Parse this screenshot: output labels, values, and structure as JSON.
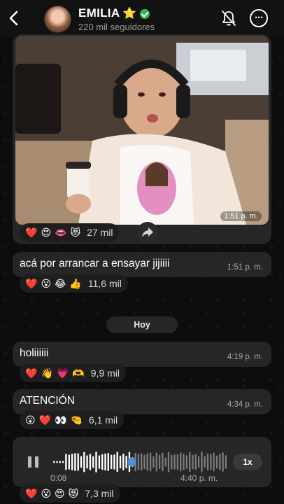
{
  "header": {
    "channel_name": "EMILIA",
    "name_star": "⭐",
    "followers": "220 mil seguidores"
  },
  "messages": [
    {
      "type": "photo",
      "time": "1:51 p. m.",
      "reactions": {
        "emojis": [
          "❤️",
          "😍",
          "👄",
          "😻"
        ],
        "count": "27 mil"
      }
    },
    {
      "type": "text",
      "text": "acá por arrancar a ensayar jijiiii",
      "time": "1:51 p. m.",
      "reactions": {
        "emojis": [
          "❤️",
          "😮",
          "😂",
          "👍"
        ],
        "count": "11,6 mil"
      }
    },
    {
      "type": "date",
      "text": "Hoy"
    },
    {
      "type": "text",
      "text": "holiiiiii",
      "time": "4:19 p. m.",
      "reactions": {
        "emojis": [
          "❤️",
          "👋",
          "💗",
          "🫶"
        ],
        "count": "9,9 mil"
      }
    },
    {
      "type": "text",
      "text": "ATENCIÓN",
      "time": "4:34 p. m.",
      "reactions": {
        "emojis": [
          "😮",
          "❤️",
          "👀",
          "🤏"
        ],
        "count": "6,1 mil"
      }
    },
    {
      "type": "voice",
      "elapsed": "0:08",
      "time": "4:40 p. m.",
      "speed": "1x",
      "progress": 0.45,
      "reactions": {
        "emojis": [
          "❤️",
          "😮",
          "😍",
          "😻"
        ],
        "count": "7,3 mil"
      }
    }
  ],
  "colors": {
    "background": "#0d0d0d",
    "bubble": "#262626",
    "verified": "#2fb84f",
    "voice_progress": "#4a8fe8"
  }
}
